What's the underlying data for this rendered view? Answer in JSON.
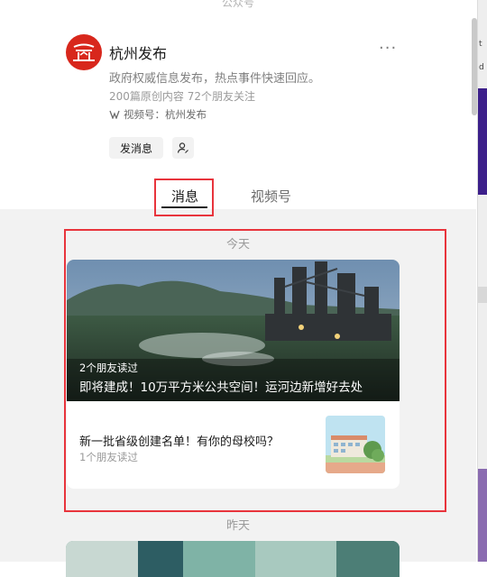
{
  "header": {
    "cut_label": "公众号"
  },
  "account": {
    "name": "杭州发布",
    "description": "政府权威信息发布，热点事件快速回应。",
    "stats": "200篇原创内容  72个朋友关注",
    "channel": "视频号：杭州发布",
    "more_label": "···",
    "avatar_color": "#d8271c"
  },
  "actions": {
    "send_message": "发消息"
  },
  "tabs": [
    {
      "label": "消息",
      "active": true
    },
    {
      "label": "视频号",
      "active": false
    }
  ],
  "feed": {
    "today_label": "今天",
    "yesterday_label": "昨天",
    "featured": {
      "read_info": "2个朋友读过",
      "title": "即将建成！10万平方米公共空间！运河边新增好去处"
    },
    "second": {
      "title": "新一批省级创建名单！有你的母校吗？",
      "read_info": "1个朋友读过"
    }
  },
  "right_strip": {
    "text_a": "t",
    "text_b": "d"
  },
  "colors": {
    "highlight": "#e8343c",
    "feed_bg": "#f2f2f2",
    "accent_red": "#d8271c"
  }
}
